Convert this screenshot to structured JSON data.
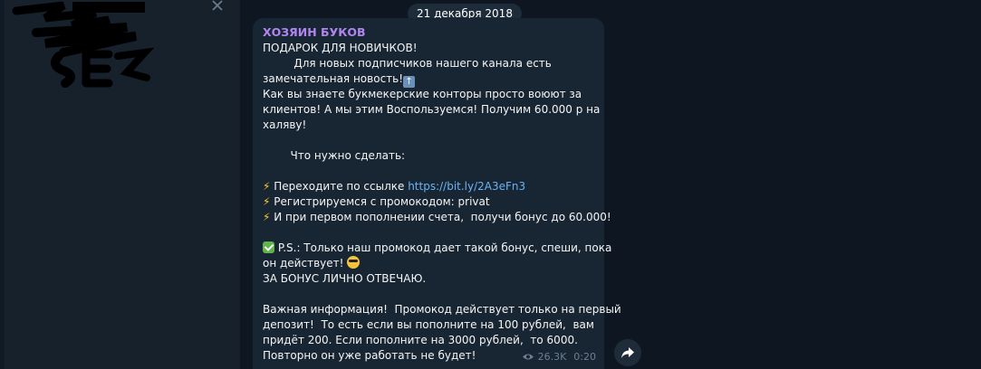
{
  "chat": {
    "date": "21 декабря 2018",
    "message": {
      "sender": "ХОЗЯИН БУКОВ",
      "lines": [
        {
          "text": "ПОДАРОК ДЛЯ НОВИЧКОВ!"
        },
        {
          "text": "         Для новых подписчиков нашего канала есть"
        },
        {
          "text": "замечательная новость!",
          "emoji": "up-arrow-emoji"
        },
        {
          "text": "Как вы знаете букмекерские конторы просто воюют за"
        },
        {
          "text": "клиентов! А мы этим Воспользуемся! Получим 60.000 р на"
        },
        {
          "text": "халяву!"
        },
        {
          "text": ""
        },
        {
          "text": "        Что нужно сделать:"
        },
        {
          "text": ""
        },
        {
          "prefix": "Переходите по ссылке ",
          "link": "https://bit.ly/2A3eFn3",
          "icon": "lightning-emoji"
        },
        {
          "text": "Регистрируемся с промокодом: privat",
          "icon": "lightning-emoji"
        },
        {
          "text": "И при первом пополнении счета,  получи бонус до 60.000!",
          "icon": "lightning-emoji"
        },
        {
          "text": ""
        },
        {
          "text": "P.S.: Только наш промокод дает такой бонус, спеши, пока",
          "icon": "check-emoji"
        },
        {
          "text": "он действует! ",
          "emoji": "sunglasses-emoji"
        },
        {
          "text": "ЗА БОНУС ЛИЧНО ОТВЕЧАЮ."
        },
        {
          "text": ""
        },
        {
          "text": "Важная информация!  Промокод действует только на первый"
        },
        {
          "text": "депозит!  То есть если вы пополните на 100 рублей,  вам"
        },
        {
          "text": "придёт 200. Если пополните на 3000 рублей,  то 6000."
        },
        {
          "text": "Повторно он уже работать не будет!"
        }
      ],
      "views": "26.3K",
      "time": "0:20"
    }
  },
  "colors": {
    "background": "#0e1621",
    "panel": "#17212b",
    "bubble": "#182533",
    "sender": "#b085f0",
    "link": "#6ab3f3",
    "meta": "#6d7f8f"
  },
  "icons": {
    "close": "close-icon",
    "eye": "eye-icon",
    "share": "share-arrow-icon"
  }
}
